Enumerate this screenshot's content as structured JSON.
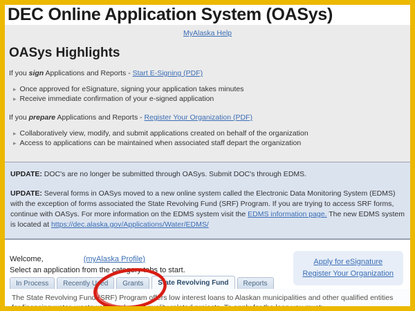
{
  "page": {
    "title": "DEC Online Application System (OASys)"
  },
  "help_link": "MyAlaska Help",
  "icons": {
    "bullet": "▸"
  },
  "highlights": {
    "heading": "OASys Highlights",
    "sign_line": {
      "prefix": "If you ",
      "emphasis": "sign",
      "middle": " Applications and Reports - ",
      "link": "Start E-Signing (PDF)"
    },
    "sign_bullets": [
      "Once approved for eSignature, signing your application takes minutes",
      "Receive immediate confirmation of your e-signed application"
    ],
    "prepare_line": {
      "prefix": "If you ",
      "emphasis": "prepare",
      "middle": " Applications and Reports - ",
      "link": "Register Your Organization (PDF)"
    },
    "prepare_bullets": [
      "Collaboratively view, modify, and submit applications created on behalf of the organization",
      "Access to applications can be maintained when associated staff depart the organization"
    ]
  },
  "updates": {
    "update1": {
      "label": "UPDATE:",
      "text": " DOC's are no longer be submitted through OASys. Submit DOC's through EDMS."
    },
    "update2": {
      "label": "UPDATE:",
      "text_before_link": " Several forms in OASys moved to a new online system called the Electronic Data Monitoring System (EDMS)  with the exception of forms associated the State Revolving Fund (SRF) Program. If you are trying to access SRF forms, continue with OASys. For more information on the EDMS system visit the ",
      "link1": "EDMS information page.",
      "text_middle": " The new EDMS system is located at ",
      "link2": "https://dec.alaska.gov/Applications/Water/EDMS/"
    }
  },
  "welcome": {
    "greeting": "Welcome,",
    "profile_link": "(myAlaska Profile)",
    "instruction": "Select an application from the category tabs to start.",
    "actions": {
      "esignature": "Apply for eSignature",
      "register": "Register Your Organization"
    }
  },
  "tabs": [
    {
      "label": "In Process",
      "active": false
    },
    {
      "label": "Recently Used",
      "active": false
    },
    {
      "label": "Grants",
      "active": false
    },
    {
      "label": "State Revolving Fund",
      "active": true
    },
    {
      "label": "Reports",
      "active": false
    }
  ],
  "tab_content": "The State Revolving Fund (SRF) Program offers low interest loans to Alaskan municipalities and other qualified entities for financing water, wastewater and water quality related projects. To apply for the loan you must:",
  "colors": {
    "frame_border": "#ECB800",
    "link_blue": "#3A6DB5",
    "update_box_bg": "#DBE3EF",
    "action_box_bg": "#E7EEF8",
    "annotation_red": "#D81E14"
  }
}
